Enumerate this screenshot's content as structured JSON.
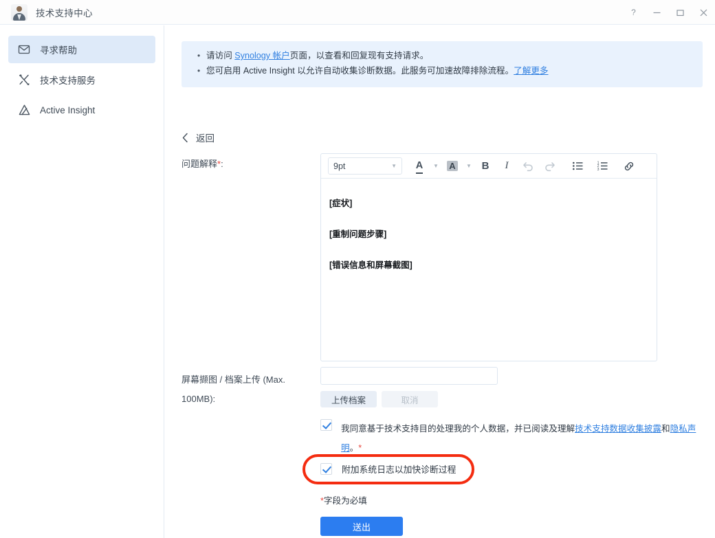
{
  "window": {
    "title": "技术支持中心",
    "app_icon": "user-avatar-icon",
    "controls": [
      {
        "name": "help-button",
        "glyph": "?"
      },
      {
        "name": "minimize-button",
        "glyph": "—"
      },
      {
        "name": "maximize-button",
        "glyph": "□"
      },
      {
        "name": "close-button",
        "glyph": "✕"
      }
    ]
  },
  "sidebar": {
    "items": [
      {
        "label": "寻求帮助",
        "icon": "envelope-icon",
        "selected": true
      },
      {
        "label": "技术支持服务",
        "icon": "tools-icon",
        "selected": false
      },
      {
        "label": "Active Insight",
        "icon": "active-insight-logo-icon",
        "selected": false
      }
    ]
  },
  "banner": {
    "line1_pre": "请访问 ",
    "line1_link": "Synology 帐户",
    "line1_post": "页面，以查看和回复现有支持请求。",
    "line2_pre": "您可启用 Active Insight 以允许自动收集诊断数据。此服务可加速故障排除流程。",
    "line2_link": "了解更多"
  },
  "back": {
    "label": "返回",
    "icon": "chevron-left-icon"
  },
  "form": {
    "problem_label": "问题解释",
    "problem_required_mark": "*",
    "problem_label_colon": ":",
    "upload_label": "屏幕撷图 / 档案上传 (Max. 100MB):",
    "upload_value": "",
    "upload_placeholder": "",
    "upload_button": "上传档案",
    "cancel_button": "取消",
    "required_note_mark": "*",
    "required_note": "字段为必填",
    "submit_button": "送出"
  },
  "editor": {
    "font_size": "9pt",
    "toolbar": [
      {
        "name": "text-color-icon",
        "label": "A"
      },
      {
        "name": "text-color-caret-icon",
        "label": "▾"
      },
      {
        "name": "highlight-color-icon",
        "label": "A"
      },
      {
        "name": "highlight-color-caret-icon",
        "label": "▾"
      },
      {
        "name": "bold-icon",
        "label": "B"
      },
      {
        "name": "italic-icon",
        "label": "I"
      },
      {
        "name": "undo-icon",
        "label": "↶"
      },
      {
        "name": "redo-icon",
        "label": "↷"
      },
      {
        "name": "bullet-list-icon",
        "label": "•≡"
      },
      {
        "name": "numbered-list-icon",
        "label": "1≡"
      },
      {
        "name": "link-icon",
        "label": "🔗"
      }
    ],
    "content": [
      "[症状]",
      "[重制问题步骤]",
      "[错误信息和屏幕截图]"
    ]
  },
  "consent": {
    "checked": true,
    "text_pre": "我同意基于技术支持目的处理我的个人数据，并已阅读及理解",
    "link1": "技术支持数据收集披露",
    "text_mid": "和",
    "link2": "隐私声明",
    "text_post": "。",
    "required_mark": "*"
  },
  "system_log": {
    "checked": true,
    "label": "附加系统日志以加快诊断过程",
    "highlight_color": "#f42c10"
  },
  "colors": {
    "accent": "#2c7df0",
    "link": "#2f7fe0",
    "banner_bg": "#e9f2fd",
    "sidebar_selected_bg": "#deeaf9",
    "required_red": "#e8453c",
    "highlight_red": "#f42c10"
  }
}
